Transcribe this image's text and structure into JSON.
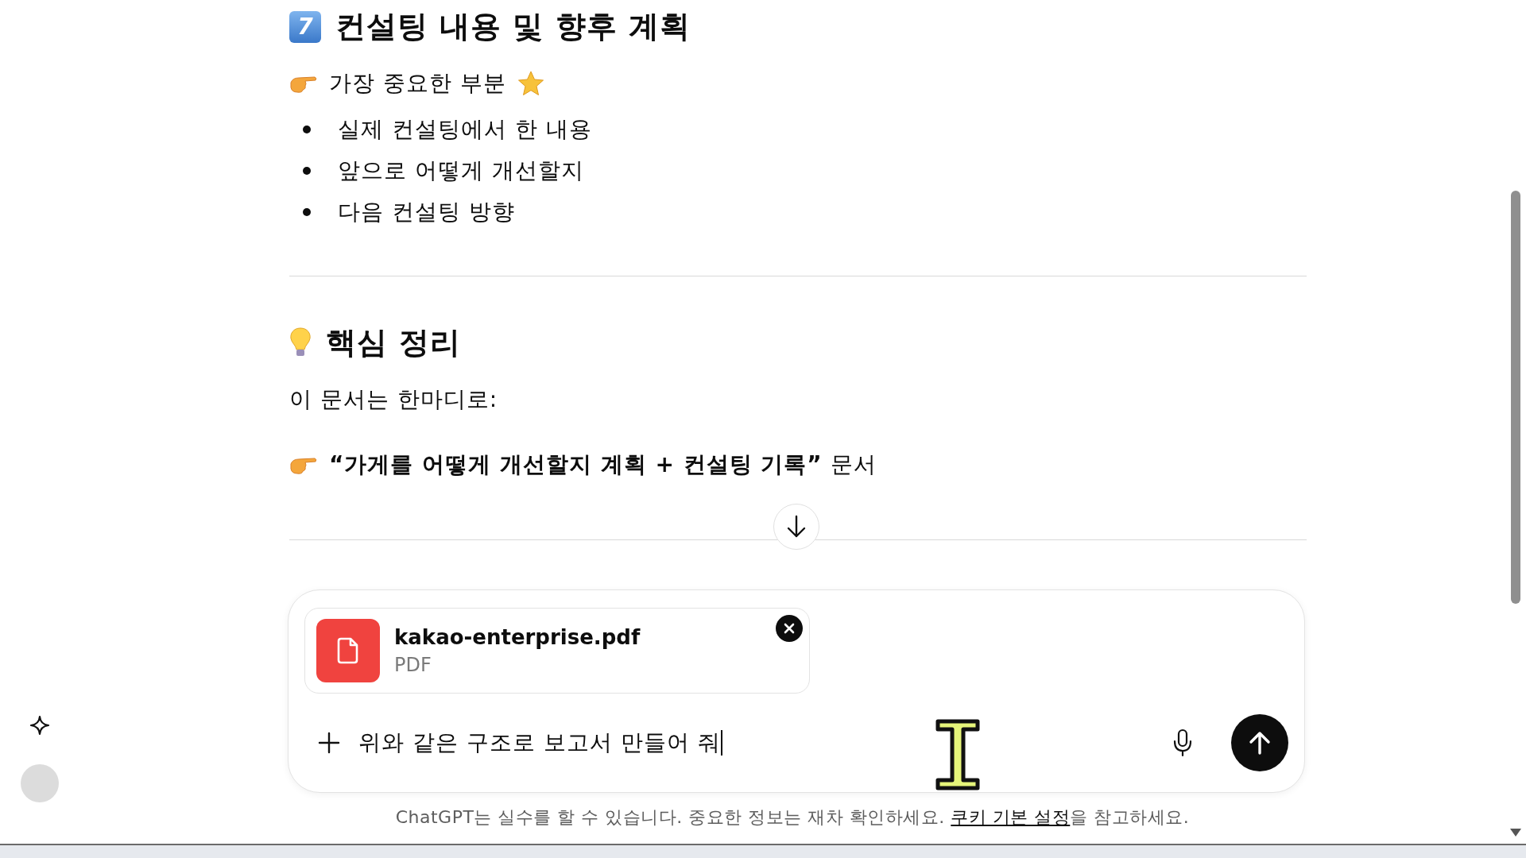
{
  "sections": [
    {
      "heading": {
        "badge": "7",
        "text": "컨설팅 내용 및 향후 계획"
      },
      "blocks": [
        {
          "kind": "pointer",
          "text": "가장 중요한 부분",
          "star": true
        },
        {
          "kind": "bullets",
          "items": [
            "실제 컨설팅에서 한 내용",
            "앞으로 어떻게 개선할지",
            "다음 컨설팅 방향"
          ]
        }
      ]
    },
    {
      "heading": {
        "text": "핵심 정리"
      },
      "blocks": [
        {
          "kind": "paragraph",
          "text": "이 문서는 한마디로:"
        },
        {
          "kind": "pointer",
          "text": "**“가게를 어떻게 개선할지 계획 + 컨설팅 기록”** 문서",
          "star": false
        }
      ]
    }
  ],
  "composer": {
    "attachment": {
      "name": "kakao-enterprise.pdf",
      "type": "PDF"
    },
    "value": "위와 같은 구조로 보고서 만들어 줘"
  },
  "footer": {
    "before": "ChatGPT는 실수를 할 수 있습니다. 중요한 정보는 재차 확인하세요. ",
    "link": "쿠키 기본 설정",
    "after": "을 참고하세요."
  }
}
